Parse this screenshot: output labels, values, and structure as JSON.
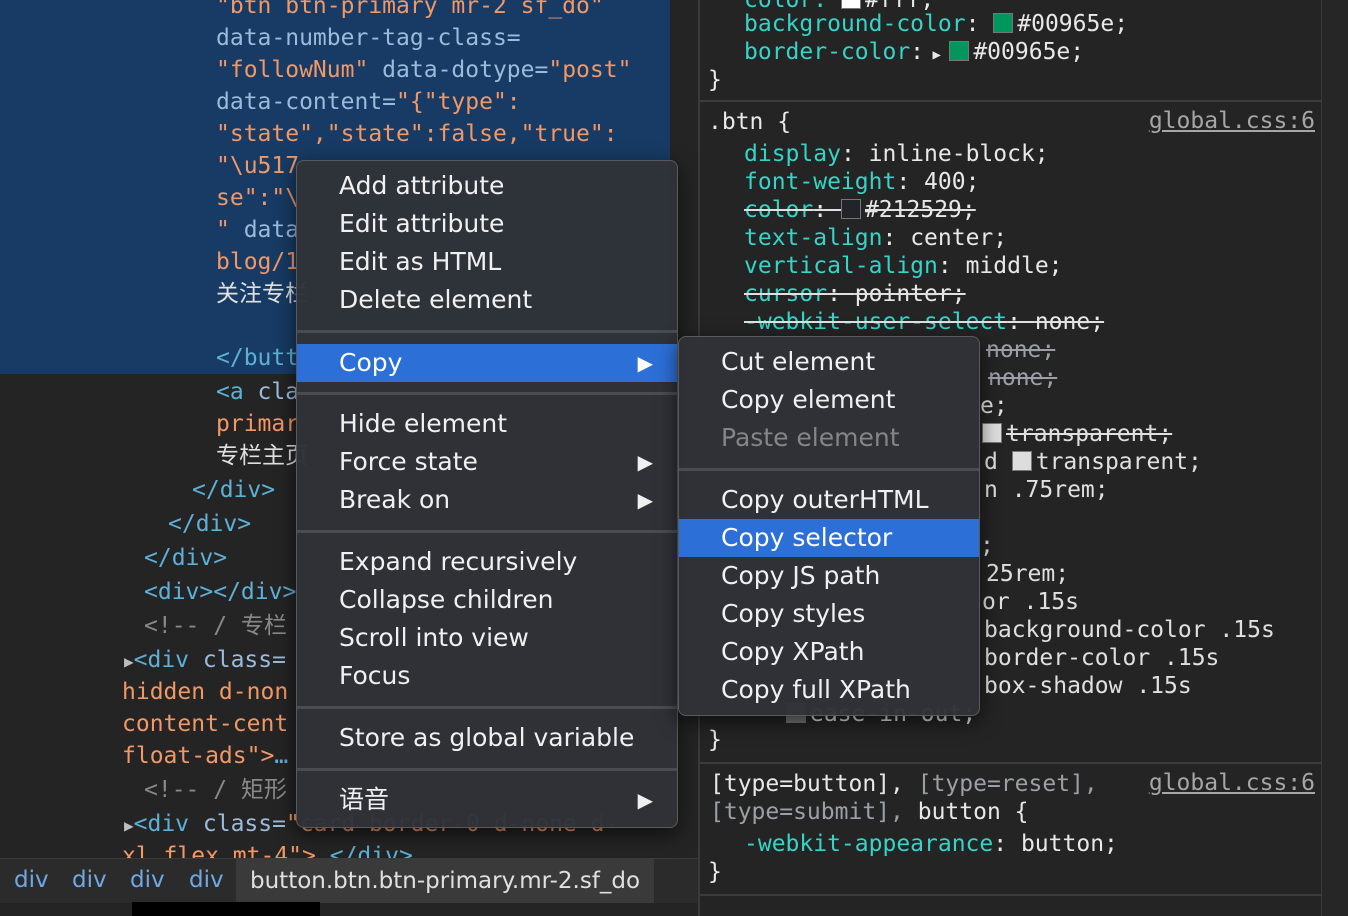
{
  "elements_panel": {
    "lines": [
      {
        "text": "\"btn btn-primary mr-2 sf_do\""
      },
      {
        "attr": "data-number-tag-class="
      },
      {
        "str": "\"followNum\"",
        "attr2": " data-dotype=",
        "str2": "\"post\""
      },
      {
        "attr": "data-content=",
        "str": "\"{\"type\":"
      },
      {
        "str": "\"state\",\"state\":false,\"true\":"
      },
      {
        "str": "\"\\u517"
      },
      {
        "str": "se\":\"\\"
      },
      {
        "str": "\"",
        "attr": " data"
      },
      {
        "str": "blog/1"
      },
      {
        "txt": "关注专栏"
      },
      {
        "tag": "</butt"
      },
      {
        "tag": "<a",
        "attr": " cla"
      },
      {
        "str": "primar"
      },
      {
        "txt": "专栏主页"
      },
      {
        "tag": "</div>"
      },
      {
        "tag": "</div>"
      },
      {
        "tag": "</div>"
      },
      {
        "tag": "<div></div>"
      },
      {
        "cmt": "<!-- / 专栏"
      },
      {
        "tag": "<div",
        "attr": " class="
      },
      {
        "str": "hidden d-non"
      },
      {
        "str": "content-cent"
      },
      {
        "str": "float-ads\">",
        "tag": "…"
      },
      {
        "cmt": "<!-- / 矩形"
      },
      {
        "tag": "<div",
        "attr": " class=",
        "str": "\"card border-0 d-none d-"
      },
      {
        "str": "xl flex mt-4\">",
        "tag": "…</div>"
      }
    ]
  },
  "styles_pane": {
    "rule1": {
      "partial_prop": "color: ",
      "partial_value": "#fff;",
      "props": [
        {
          "name": "background-color",
          "value": "#00965e;",
          "color": "#00965e"
        },
        {
          "name": "border-color",
          "value": "#00965e;",
          "color": "#00965e"
        }
      ],
      "close": "}"
    },
    "rule2": {
      "selector": ".btn {",
      "source": "global.css:6",
      "props": [
        {
          "name": "display",
          "value": "inline-block;"
        },
        {
          "name": "font-weight",
          "value": "400;"
        },
        {
          "name": "color",
          "value": "#212529;",
          "struck": true
        },
        {
          "name": "text-align",
          "value": "center;"
        },
        {
          "name": "vertical-align",
          "value": "middle;"
        },
        {
          "name": "cursor",
          "value": "pointer;",
          "struck": true
        },
        {
          "name": "-webkit-user-select",
          "value": "none;",
          "struck": true
        }
      ],
      "hidden_fragments": [
        "none;",
        "none;",
        "e;",
        "transparent;",
        "d",
        "transparent;",
        "n .75rem;",
        ";",
        "25rem;",
        "or .15s",
        "background-color .15s",
        "border-color .15s",
        "box-shadow .15s",
        "ease-in-out;"
      ],
      "close": "}"
    },
    "rule3": {
      "selector_a": "[type=button],",
      "selector_b": "[type=reset],",
      "selector_c": "[type=submit],",
      "selector_d": "button {",
      "source": "global.css:6",
      "prop": "-webkit-appearance",
      "value": "button;",
      "close": "}"
    }
  },
  "breadcrumb": [
    "div",
    "div",
    "div",
    "div"
  ],
  "breadcrumb_active": "button.btn.btn-primary.mr-2.sf_do",
  "context_menu": {
    "items": [
      "Add attribute",
      "Edit attribute",
      "Edit as HTML",
      "Delete element",
      "Copy",
      "Hide element",
      "Force state",
      "Break on",
      "Expand recursively",
      "Collapse children",
      "Scroll into view",
      "Focus",
      "Store as global variable",
      "语音"
    ],
    "highlighted": "Copy"
  },
  "copy_submenu": {
    "items": [
      "Cut element",
      "Copy element",
      "Paste element",
      "Copy outerHTML",
      "Copy selector",
      "Copy JS path",
      "Copy styles",
      "Copy XPath",
      "Copy full XPath"
    ],
    "highlighted": "Copy selector",
    "disabled": "Paste element"
  },
  "colors": {
    "accent": "#2c6fd6",
    "selection": "#173b64",
    "swatch_green": "#00965e"
  }
}
